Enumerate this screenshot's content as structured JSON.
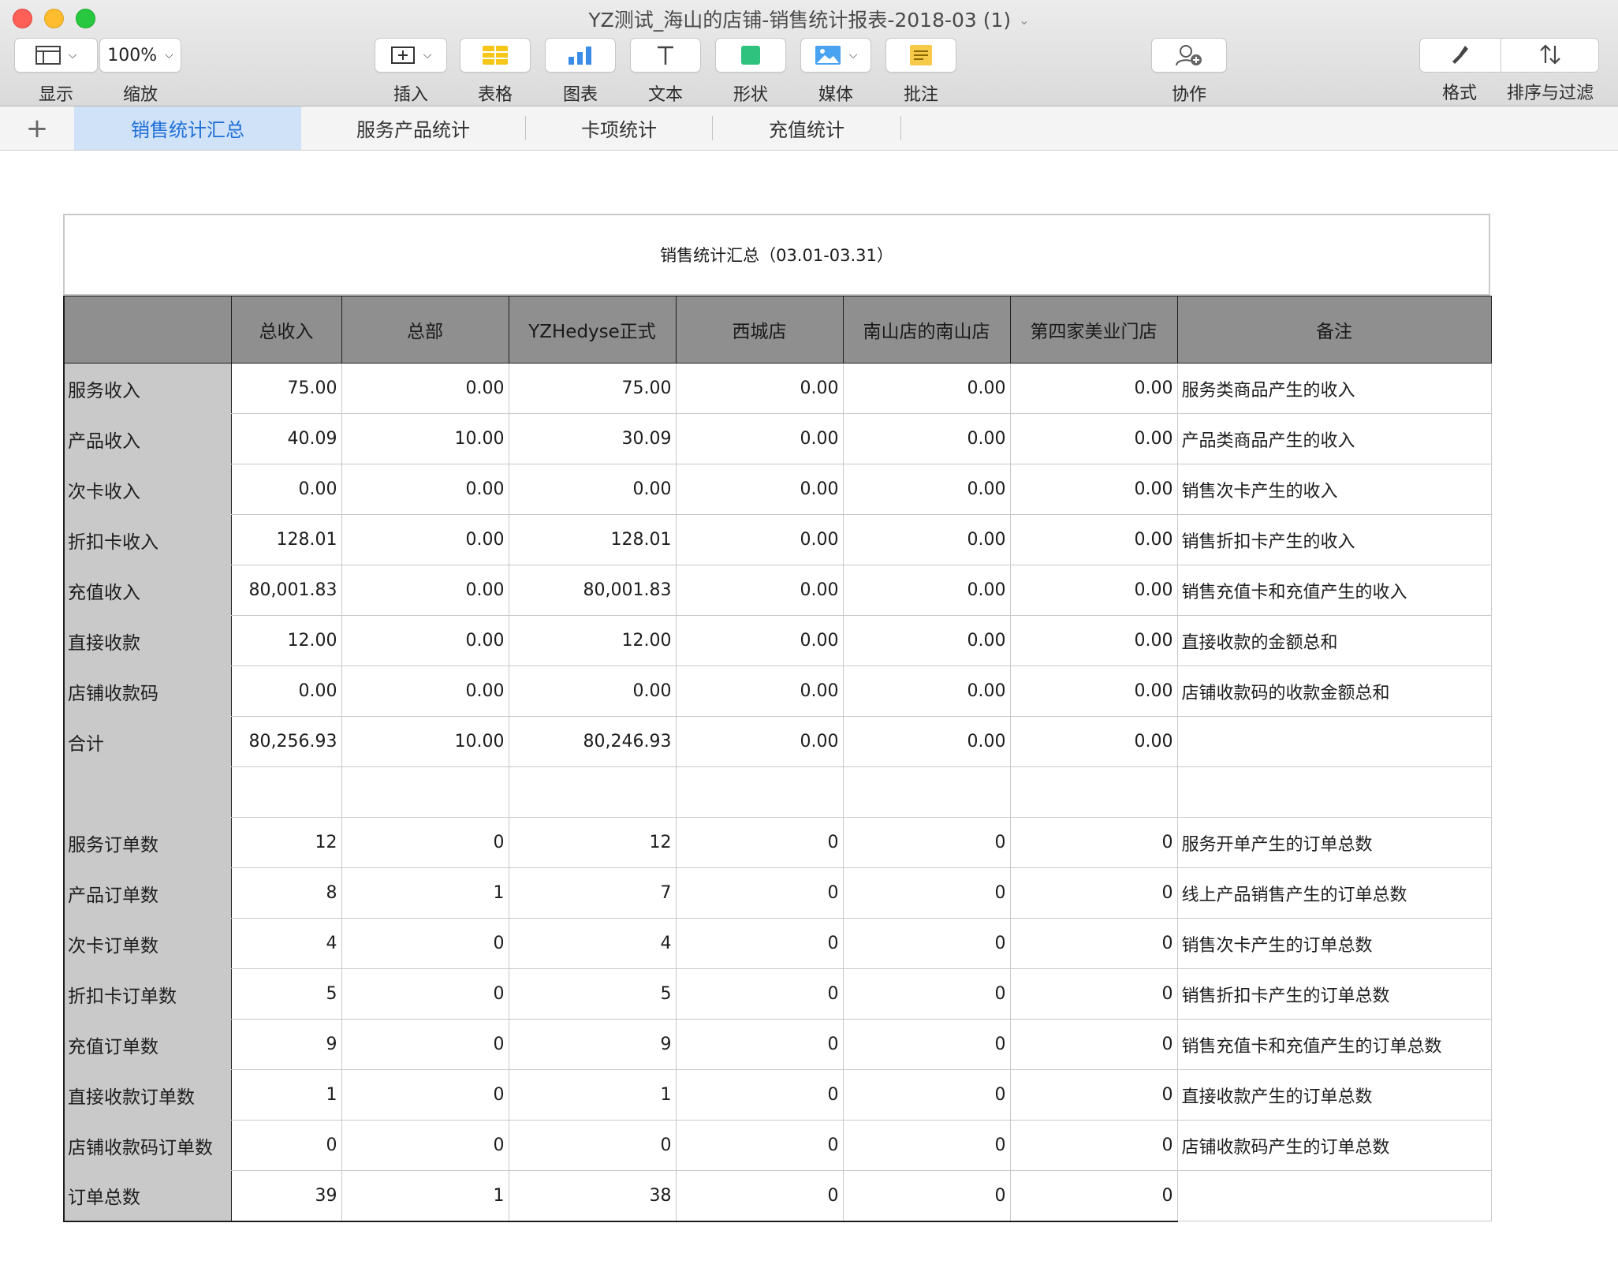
{
  "window": {
    "title": "YZ测试_海山的店铺-销售统计报表-2018-03 (1)"
  },
  "toolbar": {
    "view_label": "显示",
    "zoom_value": "100%",
    "zoom_label": "缩放",
    "insert_label": "插入",
    "table_label": "表格",
    "chart_label": "图表",
    "text_label": "文本",
    "shape_label": "形状",
    "media_label": "媒体",
    "comment_label": "批注",
    "collaborate_label": "协作",
    "format_label": "格式",
    "sort_filter_label": "排序与过滤"
  },
  "tabs": {
    "items": [
      "销售统计汇总",
      "服务产品统计",
      "卡项统计",
      "充值统计"
    ],
    "active_index": 0
  },
  "report": {
    "title": "销售统计汇总（03.01-03.31）",
    "headers": [
      "",
      "总收入",
      "总部",
      "YZHedyse正式",
      "西城店",
      "南山店的南山店",
      "第四家美业门店",
      "备注"
    ],
    "rows": [
      {
        "label": "服务收入",
        "values": [
          "75.00",
          "0.00",
          "75.00",
          "0.00",
          "0.00",
          "0.00"
        ],
        "note": "服务类商品产生的收入"
      },
      {
        "label": "产品收入",
        "values": [
          "40.09",
          "10.00",
          "30.09",
          "0.00",
          "0.00",
          "0.00"
        ],
        "note": "产品类商品产生的收入"
      },
      {
        "label": "次卡收入",
        "values": [
          "0.00",
          "0.00",
          "0.00",
          "0.00",
          "0.00",
          "0.00"
        ],
        "note": "销售次卡产生的收入"
      },
      {
        "label": "折扣卡收入",
        "values": [
          "128.01",
          "0.00",
          "128.01",
          "0.00",
          "0.00",
          "0.00"
        ],
        "note": "销售折扣卡产生的收入"
      },
      {
        "label": "充值收入",
        "values": [
          "80,001.83",
          "0.00",
          "80,001.83",
          "0.00",
          "0.00",
          "0.00"
        ],
        "note": "销售充值卡和充值产生的收入"
      },
      {
        "label": "直接收款",
        "values": [
          "12.00",
          "0.00",
          "12.00",
          "0.00",
          "0.00",
          "0.00"
        ],
        "note": "直接收款的金额总和"
      },
      {
        "label": "店铺收款码",
        "values": [
          "0.00",
          "0.00",
          "0.00",
          "0.00",
          "0.00",
          "0.00"
        ],
        "note": "店铺收款码的收款金额总和"
      },
      {
        "label": "合计",
        "values": [
          "80,256.93",
          "10.00",
          "80,246.93",
          "0.00",
          "0.00",
          "0.00"
        ],
        "note": ""
      },
      {
        "label": "",
        "values": [
          "",
          "",
          "",
          "",
          "",
          ""
        ],
        "note": ""
      },
      {
        "label": "服务订单数",
        "values": [
          "12",
          "0",
          "12",
          "0",
          "0",
          "0"
        ],
        "note": "服务开单产生的订单总数"
      },
      {
        "label": "产品订单数",
        "values": [
          "8",
          "1",
          "7",
          "0",
          "0",
          "0"
        ],
        "note": "线上产品销售产生的订单总数"
      },
      {
        "label": "次卡订单数",
        "values": [
          "4",
          "0",
          "4",
          "0",
          "0",
          "0"
        ],
        "note": "销售次卡产生的订单总数"
      },
      {
        "label": "折扣卡订单数",
        "values": [
          "5",
          "0",
          "5",
          "0",
          "0",
          "0"
        ],
        "note": "销售折扣卡产生的订单总数"
      },
      {
        "label": "充值订单数",
        "values": [
          "9",
          "0",
          "9",
          "0",
          "0",
          "0"
        ],
        "note": "销售充值卡和充值产生的订单总数"
      },
      {
        "label": "直接收款订单数",
        "values": [
          "1",
          "0",
          "1",
          "0",
          "0",
          "0"
        ],
        "note": "直接收款产生的订单总数"
      },
      {
        "label": "店铺收款码订单数",
        "values": [
          "0",
          "0",
          "0",
          "0",
          "0",
          "0"
        ],
        "note": "店铺收款码产生的订单总数"
      },
      {
        "label": "订单总数",
        "values": [
          "39",
          "1",
          "38",
          "0",
          "0",
          "0"
        ],
        "note": ""
      }
    ]
  }
}
